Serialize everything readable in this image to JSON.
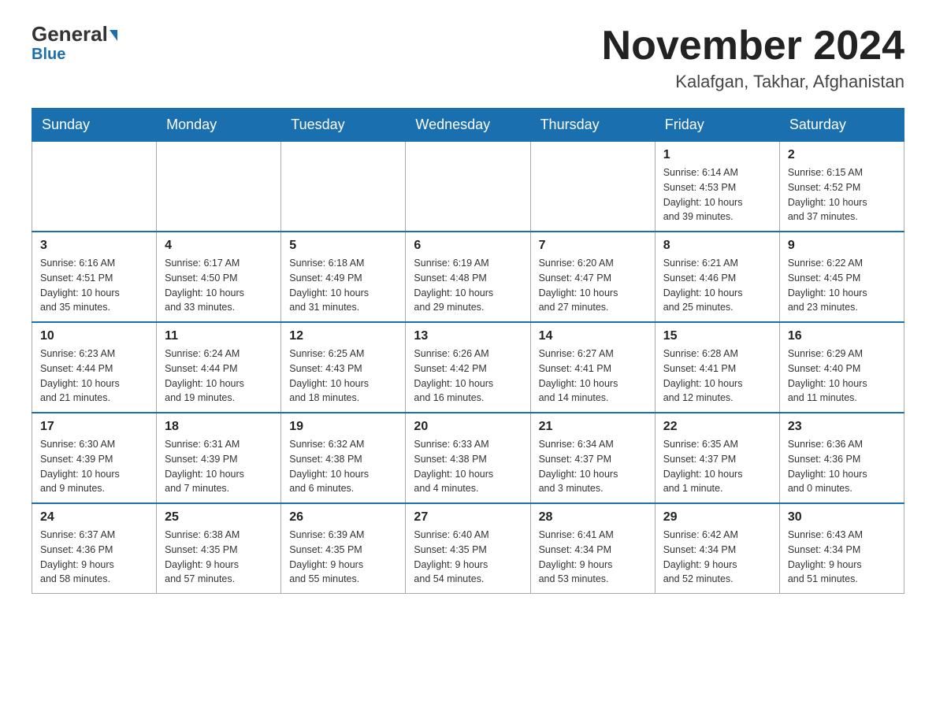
{
  "header": {
    "logo_general": "General",
    "logo_blue": "Blue",
    "month_title": "November 2024",
    "location": "Kalafgan, Takhar, Afghanistan"
  },
  "days_of_week": [
    "Sunday",
    "Monday",
    "Tuesday",
    "Wednesday",
    "Thursday",
    "Friday",
    "Saturday"
  ],
  "weeks": [
    [
      {
        "day": "",
        "info": ""
      },
      {
        "day": "",
        "info": ""
      },
      {
        "day": "",
        "info": ""
      },
      {
        "day": "",
        "info": ""
      },
      {
        "day": "",
        "info": ""
      },
      {
        "day": "1",
        "info": "Sunrise: 6:14 AM\nSunset: 4:53 PM\nDaylight: 10 hours\nand 39 minutes."
      },
      {
        "day": "2",
        "info": "Sunrise: 6:15 AM\nSunset: 4:52 PM\nDaylight: 10 hours\nand 37 minutes."
      }
    ],
    [
      {
        "day": "3",
        "info": "Sunrise: 6:16 AM\nSunset: 4:51 PM\nDaylight: 10 hours\nand 35 minutes."
      },
      {
        "day": "4",
        "info": "Sunrise: 6:17 AM\nSunset: 4:50 PM\nDaylight: 10 hours\nand 33 minutes."
      },
      {
        "day": "5",
        "info": "Sunrise: 6:18 AM\nSunset: 4:49 PM\nDaylight: 10 hours\nand 31 minutes."
      },
      {
        "day": "6",
        "info": "Sunrise: 6:19 AM\nSunset: 4:48 PM\nDaylight: 10 hours\nand 29 minutes."
      },
      {
        "day": "7",
        "info": "Sunrise: 6:20 AM\nSunset: 4:47 PM\nDaylight: 10 hours\nand 27 minutes."
      },
      {
        "day": "8",
        "info": "Sunrise: 6:21 AM\nSunset: 4:46 PM\nDaylight: 10 hours\nand 25 minutes."
      },
      {
        "day": "9",
        "info": "Sunrise: 6:22 AM\nSunset: 4:45 PM\nDaylight: 10 hours\nand 23 minutes."
      }
    ],
    [
      {
        "day": "10",
        "info": "Sunrise: 6:23 AM\nSunset: 4:44 PM\nDaylight: 10 hours\nand 21 minutes."
      },
      {
        "day": "11",
        "info": "Sunrise: 6:24 AM\nSunset: 4:44 PM\nDaylight: 10 hours\nand 19 minutes."
      },
      {
        "day": "12",
        "info": "Sunrise: 6:25 AM\nSunset: 4:43 PM\nDaylight: 10 hours\nand 18 minutes."
      },
      {
        "day": "13",
        "info": "Sunrise: 6:26 AM\nSunset: 4:42 PM\nDaylight: 10 hours\nand 16 minutes."
      },
      {
        "day": "14",
        "info": "Sunrise: 6:27 AM\nSunset: 4:41 PM\nDaylight: 10 hours\nand 14 minutes."
      },
      {
        "day": "15",
        "info": "Sunrise: 6:28 AM\nSunset: 4:41 PM\nDaylight: 10 hours\nand 12 minutes."
      },
      {
        "day": "16",
        "info": "Sunrise: 6:29 AM\nSunset: 4:40 PM\nDaylight: 10 hours\nand 11 minutes."
      }
    ],
    [
      {
        "day": "17",
        "info": "Sunrise: 6:30 AM\nSunset: 4:39 PM\nDaylight: 10 hours\nand 9 minutes."
      },
      {
        "day": "18",
        "info": "Sunrise: 6:31 AM\nSunset: 4:39 PM\nDaylight: 10 hours\nand 7 minutes."
      },
      {
        "day": "19",
        "info": "Sunrise: 6:32 AM\nSunset: 4:38 PM\nDaylight: 10 hours\nand 6 minutes."
      },
      {
        "day": "20",
        "info": "Sunrise: 6:33 AM\nSunset: 4:38 PM\nDaylight: 10 hours\nand 4 minutes."
      },
      {
        "day": "21",
        "info": "Sunrise: 6:34 AM\nSunset: 4:37 PM\nDaylight: 10 hours\nand 3 minutes."
      },
      {
        "day": "22",
        "info": "Sunrise: 6:35 AM\nSunset: 4:37 PM\nDaylight: 10 hours\nand 1 minute."
      },
      {
        "day": "23",
        "info": "Sunrise: 6:36 AM\nSunset: 4:36 PM\nDaylight: 10 hours\nand 0 minutes."
      }
    ],
    [
      {
        "day": "24",
        "info": "Sunrise: 6:37 AM\nSunset: 4:36 PM\nDaylight: 9 hours\nand 58 minutes."
      },
      {
        "day": "25",
        "info": "Sunrise: 6:38 AM\nSunset: 4:35 PM\nDaylight: 9 hours\nand 57 minutes."
      },
      {
        "day": "26",
        "info": "Sunrise: 6:39 AM\nSunset: 4:35 PM\nDaylight: 9 hours\nand 55 minutes."
      },
      {
        "day": "27",
        "info": "Sunrise: 6:40 AM\nSunset: 4:35 PM\nDaylight: 9 hours\nand 54 minutes."
      },
      {
        "day": "28",
        "info": "Sunrise: 6:41 AM\nSunset: 4:34 PM\nDaylight: 9 hours\nand 53 minutes."
      },
      {
        "day": "29",
        "info": "Sunrise: 6:42 AM\nSunset: 4:34 PM\nDaylight: 9 hours\nand 52 minutes."
      },
      {
        "day": "30",
        "info": "Sunrise: 6:43 AM\nSunset: 4:34 PM\nDaylight: 9 hours\nand 51 minutes."
      }
    ]
  ]
}
